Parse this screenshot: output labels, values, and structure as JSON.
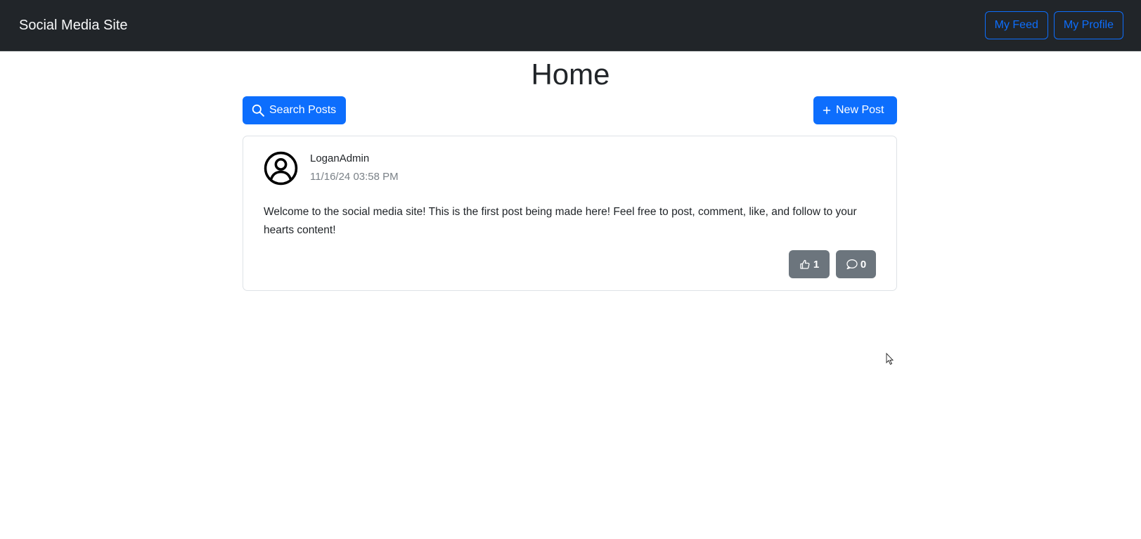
{
  "navbar": {
    "brand": "Social Media Site",
    "buttons": [
      "My Feed",
      "My Profile"
    ],
    "background": "#212529",
    "accent": "#0d6efd"
  },
  "page": {
    "title": "Home"
  },
  "actions": {
    "search_label": "Search Posts",
    "search_icon": "search-icon",
    "new_post_label": "New Post",
    "new_post_icon": "plus-icon",
    "primary_color": "#0d6efd"
  },
  "posts": [
    {
      "author": "LoganAdmin",
      "timestamp": "11/16/24 03:58 PM",
      "avatar_icon": "person-circle-icon",
      "body": "Welcome to the social media site! This is the first post being made here! Feel free to post, comment, like, and follow to your hearts content!",
      "likes": "1",
      "comments": "0",
      "like_icon": "thumbs-up-icon",
      "comment_icon": "chat-icon",
      "secondary_color": "#6c757d"
    }
  ]
}
